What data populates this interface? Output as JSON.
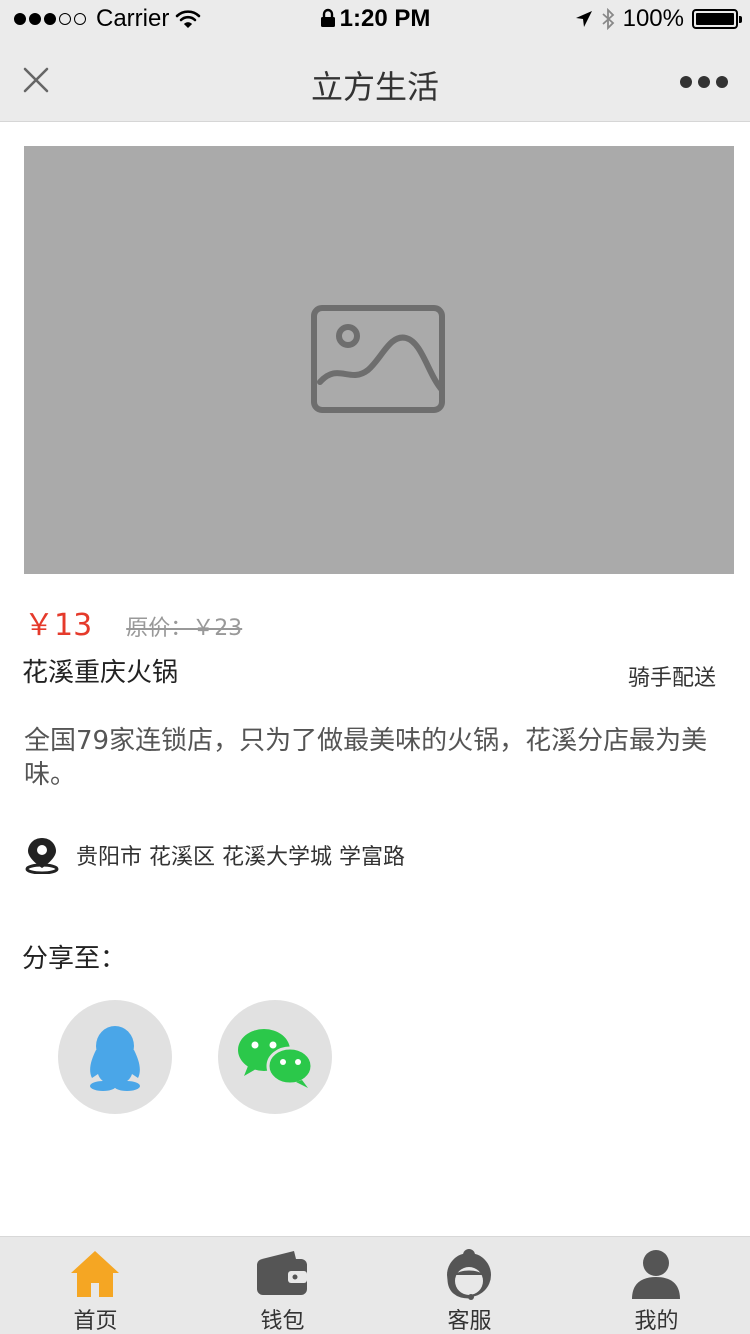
{
  "status_bar": {
    "carrier": "Carrier",
    "time": "1:20 PM",
    "battery": "100%",
    "battery_level": 1.0
  },
  "nav": {
    "title": "立方生活"
  },
  "product": {
    "price": "￥13",
    "original_price": "原价：￥23",
    "name": "花溪重庆火锅",
    "delivery": "骑手配送",
    "description": "全国79家连锁店，只为了做最美味的火锅，花溪分店最为美味。",
    "address": "贵阳市 花溪区 花溪大学城 学富路"
  },
  "share": {
    "label": "分享至："
  },
  "tabs": [
    {
      "label": "首页",
      "icon": "home-icon",
      "active": true
    },
    {
      "label": "钱包",
      "icon": "wallet-icon",
      "active": false
    },
    {
      "label": "客服",
      "icon": "customer-service-icon",
      "active": false
    },
    {
      "label": "我的",
      "icon": "user-icon",
      "active": false
    }
  ],
  "colors": {
    "accent": "#f5a623",
    "price": "#e53a2b",
    "qq": "#4aa6e8",
    "wechat": "#2bc84a",
    "placeholder": "#aaaaaa"
  }
}
